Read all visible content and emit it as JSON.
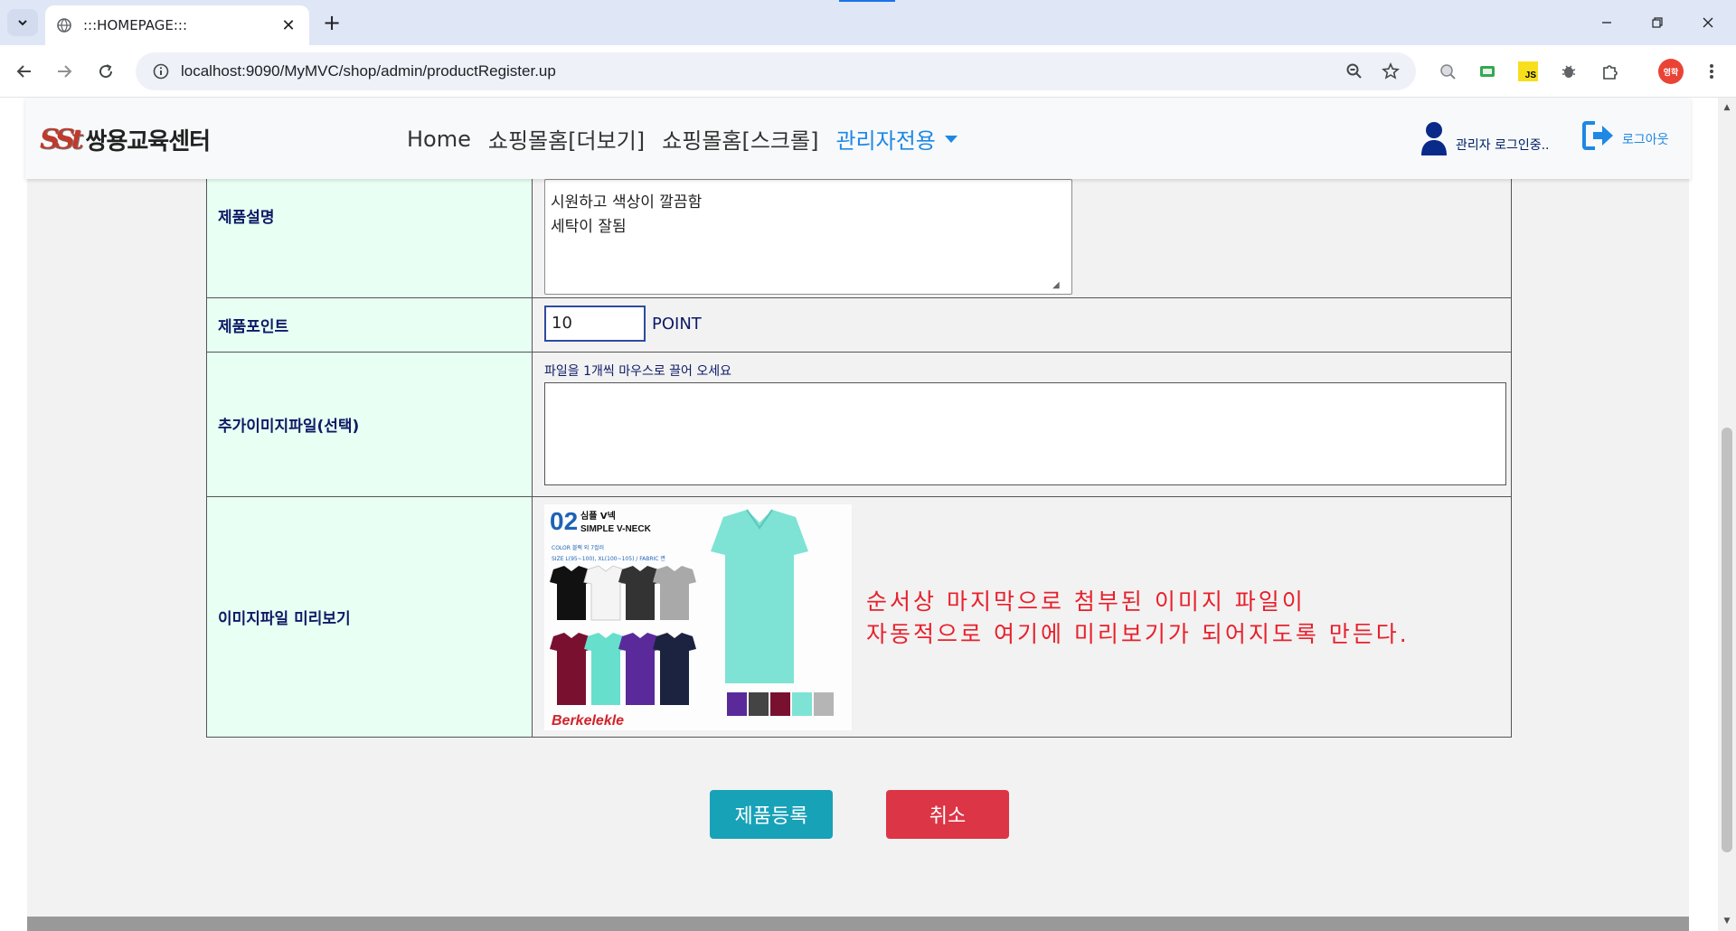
{
  "browser": {
    "tab_title": ":::HOMEPAGE:::",
    "url": "localhost:9090/MyMVC/shop/admin/productRegister.up",
    "profile_initial": "영학",
    "ext_js_label": "JS"
  },
  "site": {
    "logo_mark": "SSt",
    "logo_text": "쌍용교육센터",
    "nav": {
      "home": "Home",
      "shop_more": "쇼핑몰홈[더보기]",
      "shop_scroll": "쇼핑몰홈[스크롤]",
      "admin": "관리자전용"
    },
    "user_label": "관리자 로그인중..",
    "logout_label": "로그아웃"
  },
  "form": {
    "description": {
      "label": "제품설명",
      "value": "시원하고 색상이 깔끔함\n세탁이 잘됨"
    },
    "point": {
      "label": "제품포인트",
      "value": "10",
      "unit": "POINT"
    },
    "extra_images": {
      "label": "추가이미지파일(선택)",
      "hint": "파일을 1개씩 마우스로 끌어 오세요"
    },
    "preview": {
      "label": "이미지파일 미리보기",
      "note_line1": "순서상 마지막으로 첨부된 이미지 파일이",
      "note_line2": "자동적으로 여기에 미리보기가 되어지도록 만든다.",
      "image": {
        "number": "02",
        "title_kr": "심플 V넥",
        "title_en": "SIMPLE V-NECK",
        "color_line": "COLOR 블랙 외 7컬러",
        "size_line": "SIZE L(95~100), XL(100~105) / FABRIC 면",
        "brand": "Berkelekle"
      }
    }
  },
  "buttons": {
    "register": "제품등록",
    "cancel": "취소"
  },
  "colors": {
    "label_bg": "#e8fff3",
    "register_btn": "#17a2b8",
    "cancel_btn": "#dc3545",
    "note_text": "#e8202b",
    "link_active": "#1e88e5"
  }
}
